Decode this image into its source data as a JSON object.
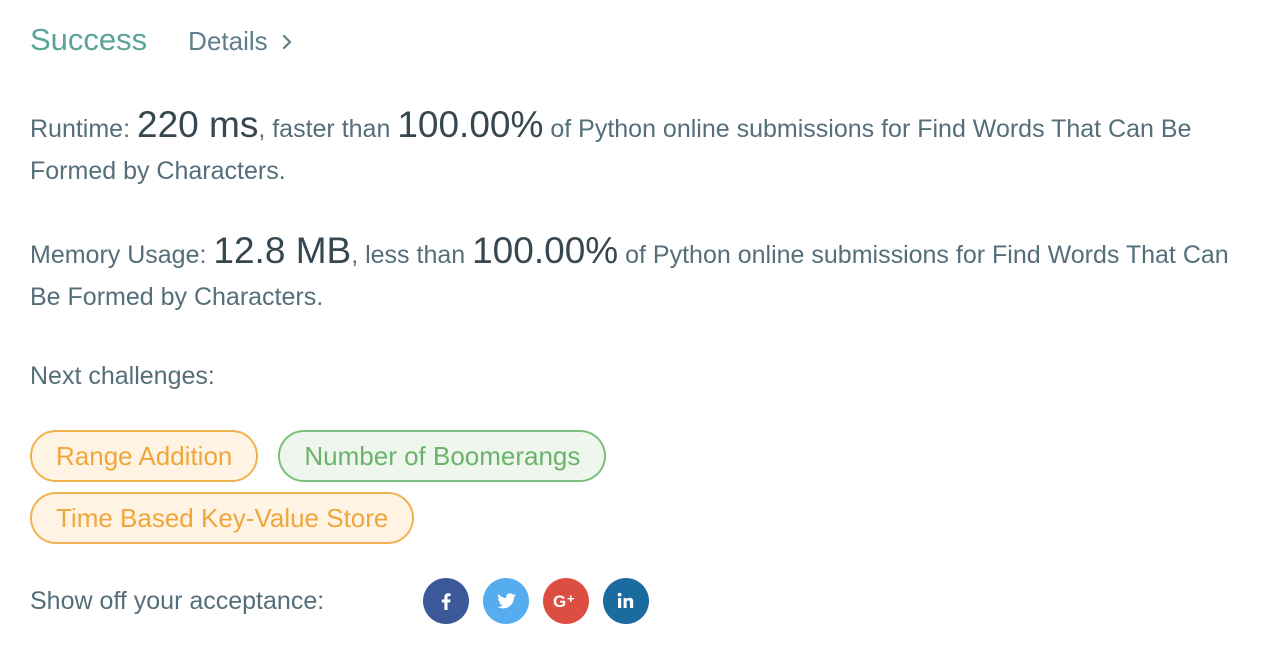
{
  "header": {
    "status": "Success",
    "details_label": "Details"
  },
  "runtime": {
    "label": "Runtime:",
    "value": "220 ms",
    "compare_text": ", faster than",
    "percent": "100.00%",
    "suffix": "of Python online submissions for Find Words That Can Be Formed by Characters."
  },
  "memory": {
    "label": "Memory Usage:",
    "value": "12.8 MB",
    "compare_text": ", less than",
    "percent": "100.00%",
    "suffix": "of Python online submissions for Find Words That Can Be Formed by Characters."
  },
  "next": {
    "label": "Next challenges:",
    "challenges": [
      {
        "title": "Range Addition",
        "difficulty": "medium"
      },
      {
        "title": "Number of Boomerangs",
        "difficulty": "easy"
      },
      {
        "title": "Time Based Key-Value Store",
        "difficulty": "medium"
      }
    ]
  },
  "share": {
    "label": "Show off your acceptance:",
    "icons": [
      {
        "name": "facebook-icon",
        "color": "#3b5998"
      },
      {
        "name": "twitter-icon",
        "color": "#55acee"
      },
      {
        "name": "google-plus-icon",
        "color": "#dc4e41"
      },
      {
        "name": "linkedin-icon",
        "color": "#0e76a8"
      }
    ]
  },
  "colors": {
    "success": "#5aa597",
    "medium_border": "#f0b250",
    "medium_text": "#efa63c",
    "easy_border": "#7cbf7c",
    "easy_text": "#6bb36b"
  }
}
